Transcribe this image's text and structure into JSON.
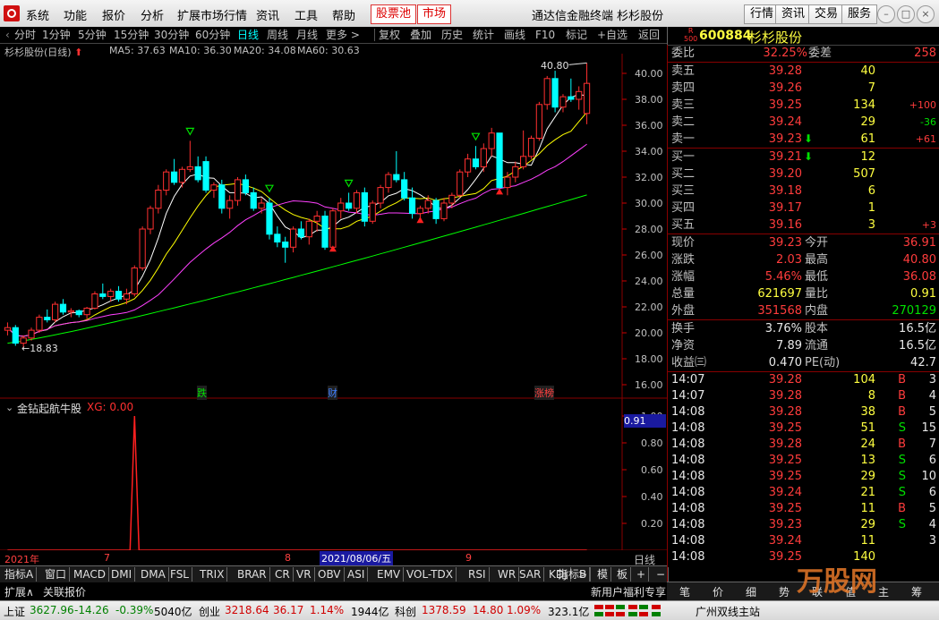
{
  "menu": {
    "items": [
      "系统",
      "功能",
      "报价",
      "分析",
      "扩展市场行情",
      "资讯",
      "工具",
      "帮助"
    ],
    "red_items": [
      "股票池",
      "市场"
    ],
    "title": "通达信金融终端 杉杉股份",
    "right_buttons": [
      "行情",
      "资讯",
      "交易",
      "服务"
    ]
  },
  "toolbar": {
    "periods": [
      "分时",
      "1分钟",
      "5分钟",
      "15分钟",
      "30分钟",
      "60分钟",
      "日线",
      "周线",
      "月线",
      "更多 >"
    ],
    "active_period": "日线",
    "actions": [
      "复权",
      "叠加",
      "历史",
      "统计",
      "画线",
      "F10",
      "标记",
      "+自选",
      "返回"
    ]
  },
  "quote_head": {
    "badge_top": "R",
    "badge_bottom": "500",
    "code": "600884",
    "name": "杉杉股份"
  },
  "chart": {
    "title": "杉杉股份(日线)",
    "ma": [
      {
        "label": "MA5: 37.63",
        "color": "#ffffff"
      },
      {
        "label": "MA10: 36.30",
        "color": "#ffff00"
      },
      {
        "label": "MA20: 34.08",
        "color": "#ff40ff"
      },
      {
        "label": "MA60: 30.63",
        "color": "#00ff00"
      }
    ],
    "high_label": "40.80",
    "low_label": "←18.83",
    "events": [
      {
        "text": "跌",
        "color": "#00e000"
      },
      {
        "text": "财",
        "color": "#4080ff"
      },
      {
        "text": "涨榜",
        "color": "#ff4040"
      }
    ]
  },
  "chart_data": {
    "type": "candlestick",
    "ylim": [
      15,
      41.5
    ],
    "yticks": [
      40,
      38,
      36,
      34,
      32,
      30,
      28,
      26,
      24,
      22,
      20,
      18,
      16
    ],
    "ytick_labels": [
      "40.00",
      "38.00",
      "36.00",
      "34.00",
      "32.00",
      "30.00",
      "28.00",
      "26.00",
      "24.00",
      "22.00",
      "20.00",
      "18.00",
      "16.00"
    ],
    "candles": [
      [
        20.2,
        20.8,
        19.8,
        20.4
      ],
      [
        20.4,
        20.6,
        19.0,
        19.2
      ],
      [
        19.2,
        19.8,
        18.83,
        19.6
      ],
      [
        19.6,
        20.4,
        19.4,
        20.2
      ],
      [
        20.2,
        21.4,
        20.0,
        21.2
      ],
      [
        21.2,
        21.8,
        20.8,
        21.0
      ],
      [
        21.0,
        22.4,
        20.8,
        22.2
      ],
      [
        22.2,
        22.6,
        21.4,
        21.6
      ],
      [
        21.6,
        21.9,
        21.2,
        21.7
      ],
      [
        21.7,
        21.8,
        21.2,
        21.4
      ],
      [
        21.4,
        22.0,
        21.0,
        21.9
      ],
      [
        21.9,
        23.2,
        21.8,
        23.0
      ],
      [
        23.0,
        23.8,
        22.6,
        22.8
      ],
      [
        22.8,
        23.4,
        22.4,
        23.2
      ],
      [
        23.2,
        23.6,
        22.4,
        22.6
      ],
      [
        22.6,
        23.4,
        22.2,
        23.0
      ],
      [
        23.0,
        25.2,
        22.8,
        25.0
      ],
      [
        25.0,
        28.2,
        24.8,
        28.0
      ],
      [
        28.0,
        29.8,
        27.6,
        29.6
      ],
      [
        29.6,
        31.4,
        29.2,
        31.0
      ],
      [
        31.0,
        32.6,
        30.6,
        32.4
      ],
      [
        32.4,
        33.4,
        31.4,
        31.6
      ],
      [
        31.6,
        32.8,
        31.2,
        32.6
      ],
      [
        32.6,
        34.8,
        32.4,
        32.8
      ],
      [
        32.8,
        33.6,
        31.6,
        31.8
      ],
      [
        33.2,
        33.6,
        30.8,
        31.0
      ],
      [
        31.0,
        31.6,
        30.4,
        31.4
      ],
      [
        31.4,
        31.8,
        29.2,
        29.6
      ],
      [
        29.6,
        30.6,
        28.8,
        30.2
      ],
      [
        30.2,
        32.0,
        29.8,
        31.8
      ],
      [
        31.8,
        32.2,
        30.6,
        30.8
      ],
      [
        30.8,
        31.2,
        29.4,
        29.6
      ],
      [
        29.6,
        30.4,
        29.2,
        30.0
      ],
      [
        30.0,
        30.4,
        27.2,
        27.6
      ],
      [
        27.6,
        28.2,
        26.6,
        27.0
      ],
      [
        27.0,
        27.4,
        25.4,
        26.6
      ],
      [
        26.6,
        28.2,
        26.2,
        28.0
      ],
      [
        28.0,
        28.6,
        27.2,
        27.4
      ],
      [
        27.4,
        28.8,
        26.8,
        28.6
      ],
      [
        28.6,
        29.4,
        27.8,
        29.0
      ],
      [
        29.0,
        29.4,
        26.4,
        26.6
      ],
      [
        26.6,
        29.6,
        26.4,
        29.4
      ],
      [
        29.4,
        30.4,
        28.8,
        30.0
      ],
      [
        30.0,
        30.8,
        29.4,
        29.6
      ],
      [
        29.6,
        31.0,
        29.2,
        30.8
      ],
      [
        30.8,
        31.2,
        28.2,
        28.6
      ],
      [
        28.6,
        30.2,
        28.4,
        30.0
      ],
      [
        30.0,
        31.4,
        29.6,
        31.2
      ],
      [
        31.2,
        32.4,
        30.8,
        32.2
      ],
      [
        32.2,
        34.0,
        31.6,
        31.8
      ],
      [
        31.8,
        32.4,
        30.2,
        30.4
      ],
      [
        30.4,
        31.2,
        28.8,
        29.2
      ],
      [
        29.2,
        29.8,
        28.6,
        29.6
      ],
      [
        29.6,
        30.6,
        29.2,
        30.2
      ],
      [
        30.2,
        30.4,
        28.4,
        28.8
      ],
      [
        28.8,
        30.4,
        28.6,
        30.0
      ],
      [
        30.0,
        30.8,
        29.6,
        30.6
      ],
      [
        30.6,
        32.6,
        30.4,
        32.4
      ],
      [
        32.4,
        33.8,
        32.0,
        33.4
      ],
      [
        33.4,
        34.4,
        32.6,
        32.8
      ],
      [
        32.8,
        34.6,
        32.4,
        34.2
      ],
      [
        34.2,
        35.8,
        33.6,
        35.4
      ],
      [
        35.4,
        33.8,
        30.8,
        31.2
      ],
      [
        31.2,
        32.4,
        30.6,
        32.0
      ],
      [
        32.0,
        33.2,
        31.6,
        32.8
      ],
      [
        32.8,
        35.6,
        32.6,
        33.6
      ],
      [
        33.6,
        35.2,
        33.4,
        35.0
      ],
      [
        35.0,
        37.8,
        34.8,
        37.6
      ],
      [
        37.6,
        39.8,
        37.2,
        39.6
      ],
      [
        39.6,
        40.2,
        37.0,
        37.4
      ],
      [
        37.4,
        38.4,
        37.0,
        38.2
      ],
      [
        38.2,
        39.6,
        37.8,
        38.0
      ],
      [
        38.0,
        39.0,
        37.2,
        38.6
      ],
      [
        36.91,
        40.8,
        36.08,
        39.23
      ]
    ],
    "down_markers": [
      23,
      33,
      43,
      59
    ],
    "up_markers": [
      41,
      52,
      62
    ],
    "ma60_start": 19.2,
    "ma60_end": 30.63,
    "indicator": {
      "title": "金钻起航牛股",
      "series_label": "XG: 0.00",
      "ylim": [
        0,
        1.1
      ],
      "yticks": [
        1.0,
        0.8,
        0.6,
        0.4,
        0.2
      ],
      "ytick_labels": [
        "1.00",
        "0.80",
        "0.60",
        "0.40",
        "0.20"
      ],
      "highlight_value": "0.91",
      "spike_index": 16
    },
    "x_labels": [
      "2021年",
      "7",
      "8",
      "2021/08/06/五",
      "9"
    ],
    "x_period_label": "日线"
  },
  "indicator_tabs": [
    "指标A",
    "窗口",
    "MACD",
    "DMI",
    "DMA",
    "FSL",
    "TRIX",
    "BRAR",
    "CR",
    "VR",
    "OBV",
    "ASI",
    "EMV",
    "VOL-TDX",
    "RSI",
    "WR",
    "SAR",
    "KDJ",
    ">"
  ],
  "indicator_tabs_right": [
    "指标B",
    "模",
    "板",
    "+",
    "−"
  ],
  "ext_row": {
    "expand": "扩展∧",
    "related": "关联报价",
    "promo": "新用户福利专享"
  },
  "quote": {
    "weibi": {
      "label": "委比",
      "value": "32.25%",
      "label2": "委差",
      "value2": "258"
    },
    "sell": [
      {
        "label": "卖五",
        "price": "39.28",
        "vol": "40",
        "chg": ""
      },
      {
        "label": "卖四",
        "price": "39.26",
        "vol": "7",
        "chg": ""
      },
      {
        "label": "卖三",
        "price": "39.25",
        "vol": "134",
        "chg": "+100"
      },
      {
        "label": "卖二",
        "price": "39.24",
        "vol": "29",
        "chg": "-36"
      },
      {
        "label": "卖一",
        "price": "39.23",
        "vol": "61",
        "chg": "+61"
      }
    ],
    "buy": [
      {
        "label": "买一",
        "price": "39.21",
        "vol": "12",
        "chg": ""
      },
      {
        "label": "买二",
        "price": "39.20",
        "vol": "507",
        "chg": ""
      },
      {
        "label": "买三",
        "price": "39.18",
        "vol": "6",
        "chg": ""
      },
      {
        "label": "买四",
        "price": "39.17",
        "vol": "1",
        "chg": ""
      },
      {
        "label": "买五",
        "price": "39.16",
        "vol": "3",
        "chg": "+3"
      }
    ],
    "stats": [
      {
        "l1": "现价",
        "v1": "39.23",
        "l2": "今开",
        "v2": "36.91",
        "c1": "red",
        "c2": "red"
      },
      {
        "l1": "涨跌",
        "v1": "2.03",
        "l2": "最高",
        "v2": "40.80",
        "c1": "red",
        "c2": "red"
      },
      {
        "l1": "涨幅",
        "v1": "5.46%",
        "l2": "最低",
        "v2": "36.08",
        "c1": "red",
        "c2": "red"
      },
      {
        "l1": "总量",
        "v1": "621697",
        "l2": "量比",
        "v2": "0.91",
        "c1": "yellow",
        "c2": "yellow"
      },
      {
        "l1": "外盘",
        "v1": "351568",
        "l2": "内盘",
        "v2": "270129",
        "c1": "red",
        "c2": "green"
      }
    ],
    "fund": [
      {
        "l1": "换手",
        "v1": "3.76%",
        "l2": "股本",
        "v2": "16.5亿"
      },
      {
        "l1": "净资",
        "v1": "7.89",
        "l2": "流通",
        "v2": "16.5亿"
      },
      {
        "l1": "收益㈢",
        "v1": "0.470",
        "l2": "PE(动)",
        "v2": "42.7"
      }
    ],
    "ticks": [
      {
        "t": "14:07",
        "p": "39.28",
        "v": "104",
        "d": "B",
        "n": "3"
      },
      {
        "t": "14:07",
        "p": "39.28",
        "v": "8",
        "d": "B",
        "n": "4"
      },
      {
        "t": "14:08",
        "p": "39.28",
        "v": "38",
        "d": "B",
        "n": "5"
      },
      {
        "t": "14:08",
        "p": "39.25",
        "v": "51",
        "d": "S",
        "n": "15"
      },
      {
        "t": "14:08",
        "p": "39.28",
        "v": "24",
        "d": "B",
        "n": "7"
      },
      {
        "t": "14:08",
        "p": "39.25",
        "v": "13",
        "d": "S",
        "n": "6"
      },
      {
        "t": "14:08",
        "p": "39.25",
        "v": "29",
        "d": "S",
        "n": "10"
      },
      {
        "t": "14:08",
        "p": "39.24",
        "v": "21",
        "d": "S",
        "n": "6"
      },
      {
        "t": "14:08",
        "p": "39.25",
        "v": "11",
        "d": "B",
        "n": "5"
      },
      {
        "t": "14:08",
        "p": "39.23",
        "v": "29",
        "d": "S",
        "n": "4"
      },
      {
        "t": "14:08",
        "p": "39.24",
        "v": "11",
        "d": "",
        "n": "3"
      },
      {
        "t": "14:08",
        "p": "39.25",
        "v": "140",
        "d": "",
        "n": ""
      }
    ],
    "tabs": [
      "笔",
      "价",
      "细",
      "势",
      "联",
      "值",
      "主",
      "筹"
    ]
  },
  "status": {
    "sh": {
      "name": "上证",
      "val": "3627.96",
      "chg": "-14.26",
      "pct": "-0.39%",
      "amt": "5040亿"
    },
    "cy": {
      "name": "创业",
      "val": "3218.64",
      "chg": "36.17",
      "pct": "1.14%",
      "amt": "1944亿"
    },
    "kc": {
      "name": "科创",
      "val": "1378.59",
      "chg": "14.80",
      "pct": "1.09%",
      "amt": "323.1亿"
    },
    "server": "广州双线主站"
  },
  "watermark": "万股网"
}
